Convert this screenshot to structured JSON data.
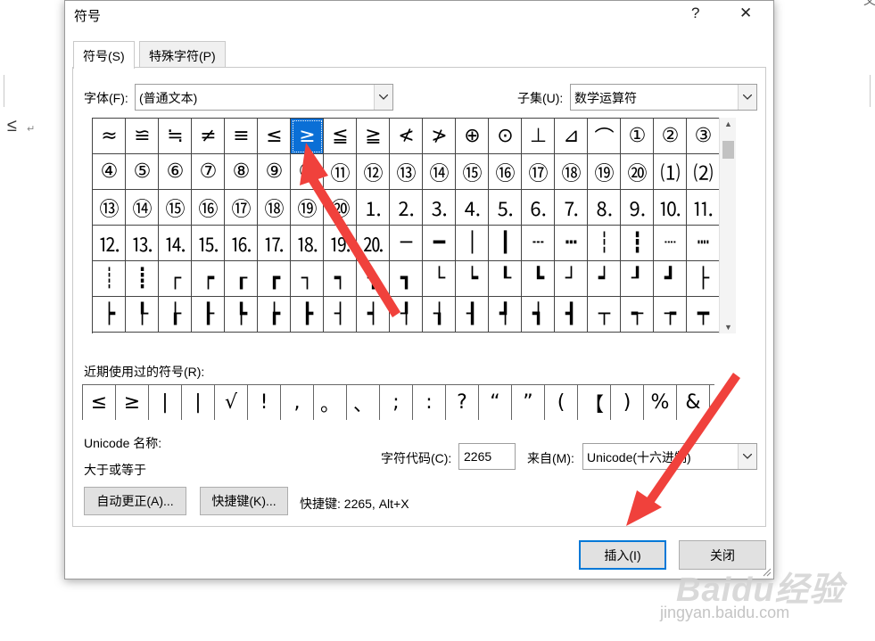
{
  "background": {
    "left_symbol": "≤",
    "para_mark": "↵",
    "corner_text": "文"
  },
  "dialog": {
    "title": "符号",
    "help": "?",
    "close": "✕"
  },
  "tabs": [
    {
      "label": "符号(S)"
    },
    {
      "label": "特殊字符(P)"
    }
  ],
  "font": {
    "label": "字体(F):",
    "value": "(普通文本)"
  },
  "subset": {
    "label": "子集(U):",
    "value": "数学运算符"
  },
  "symbols": [
    "≈",
    "≌",
    "≒",
    "≠",
    "≡",
    "≤",
    "≥",
    "≦",
    "≧",
    "≮",
    "≯",
    "⊕",
    "⊙",
    "⊥",
    "⊿",
    "⌒",
    "①",
    "②",
    "③",
    "④",
    "⑤",
    "⑥",
    "⑦",
    "⑧",
    "⑨",
    "⑩",
    "⑪",
    "⑫",
    "⑬",
    "⑭",
    "⑮",
    "⑯",
    "⑰",
    "⑱",
    "⑲",
    "⑳",
    "⑴",
    "⑵",
    "⑬",
    "⑭",
    "⑮",
    "⑯",
    "⑰",
    "⑱",
    "⑲",
    "⑳",
    "⒈",
    "⒉",
    "⒊",
    "⒋",
    "⒌",
    "⒍",
    "⒎",
    "⒏",
    "⒐",
    "⒑",
    "⒒",
    "⒓",
    "⒔",
    "⒕",
    "⒖",
    "⒗",
    "⒘",
    "⒙",
    "⒚",
    "⒛",
    "─",
    "━",
    "│",
    "┃",
    "┄",
    "┅",
    "┆",
    "┇",
    "┈",
    "┉",
    "┊",
    "┋",
    "┌",
    "┍",
    "┎",
    "┏",
    "┐",
    "┑",
    "┒",
    "┓",
    "└",
    "┕",
    "┖",
    "┗",
    "┘",
    "┙",
    "┚",
    "┛",
    "├",
    "┝",
    "┞",
    "┟",
    "┠",
    "┡",
    "┢",
    "┣",
    "┤",
    "┥",
    "┦",
    "┧",
    "┨",
    "┩",
    "┪",
    "┫",
    "┬",
    "┭",
    "┮",
    "┯"
  ],
  "selected_symbol": "≥",
  "recent": {
    "label": "近期使用过的符号(R):",
    "items": [
      "≤",
      "≥",
      "|",
      "|",
      "√",
      "!",
      ",",
      "。",
      "、",
      ";",
      ":",
      "?",
      "“",
      "”",
      "(",
      "【",
      ")",
      "%",
      "&"
    ]
  },
  "unicode_name": {
    "label": "Unicode 名称:",
    "value": "大于或等于"
  },
  "char_code": {
    "label": "字符代码(C):",
    "value": "2265"
  },
  "from": {
    "label": "来自(M):",
    "value": "Unicode(十六进制)"
  },
  "buttons": {
    "autocorrect": "自动更正(A)...",
    "shortcut": "快捷键(K)...",
    "insert": "插入(I)",
    "close": "关闭"
  },
  "shortcut_text": "快捷键: 2265, Alt+X",
  "watermark": {
    "brand": "Baidu经验",
    "url": "jingyan.baidu.com"
  },
  "colors": {
    "selection": "#0a6fd6",
    "arrow": "#f0413c",
    "primary_border": "#0078d7"
  }
}
